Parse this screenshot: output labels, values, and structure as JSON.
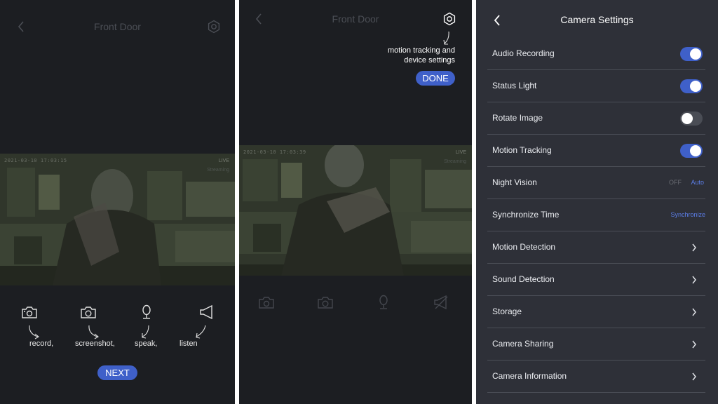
{
  "panel1": {
    "title": "Front Door",
    "video": {
      "timestamp": "2021-03-10 17:03:15",
      "live": "LIVE",
      "status": "Streaming"
    },
    "toolbar": [
      {
        "icon": "record-icon",
        "label": "record,"
      },
      {
        "icon": "camera-icon",
        "label": "screenshot,"
      },
      {
        "icon": "microphone-icon",
        "label": "speak,"
      },
      {
        "icon": "speaker-icon",
        "label": "listen"
      }
    ],
    "next_label": "NEXT"
  },
  "panel2": {
    "title": "Front Door",
    "hint": "motion tracking and\ndevice settings",
    "done_label": "DONE",
    "video": {
      "timestamp": "2021-03-10 17:03:39",
      "live": "LIVE",
      "status": "Streaming"
    }
  },
  "panel3": {
    "title": "Camera Settings",
    "rows": [
      {
        "label": "Audio Recording",
        "control": "toggle",
        "state": "on"
      },
      {
        "label": "Status Light",
        "control": "toggle",
        "state": "on"
      },
      {
        "label": "Rotate Image",
        "control": "toggle",
        "state": "off"
      },
      {
        "label": "Motion Tracking",
        "control": "toggle",
        "state": "on"
      },
      {
        "label": "Night Vision",
        "control": "options",
        "options": [
          "OFF",
          "Auto"
        ],
        "selected": "Auto"
      },
      {
        "label": "Synchronize Time",
        "control": "action",
        "action": "Synchronize"
      },
      {
        "label": "Motion Detection",
        "control": "chevron"
      },
      {
        "label": "Sound Detection",
        "control": "chevron"
      },
      {
        "label": "Storage",
        "control": "chevron"
      },
      {
        "label": "Camera Sharing",
        "control": "chevron"
      },
      {
        "label": "Camera Information",
        "control": "chevron"
      }
    ]
  },
  "colors": {
    "accent": "#3f60c9",
    "panel_bg": "#1c1e22",
    "settings_bg": "#2e3038",
    "divider": "#4b4e57"
  }
}
